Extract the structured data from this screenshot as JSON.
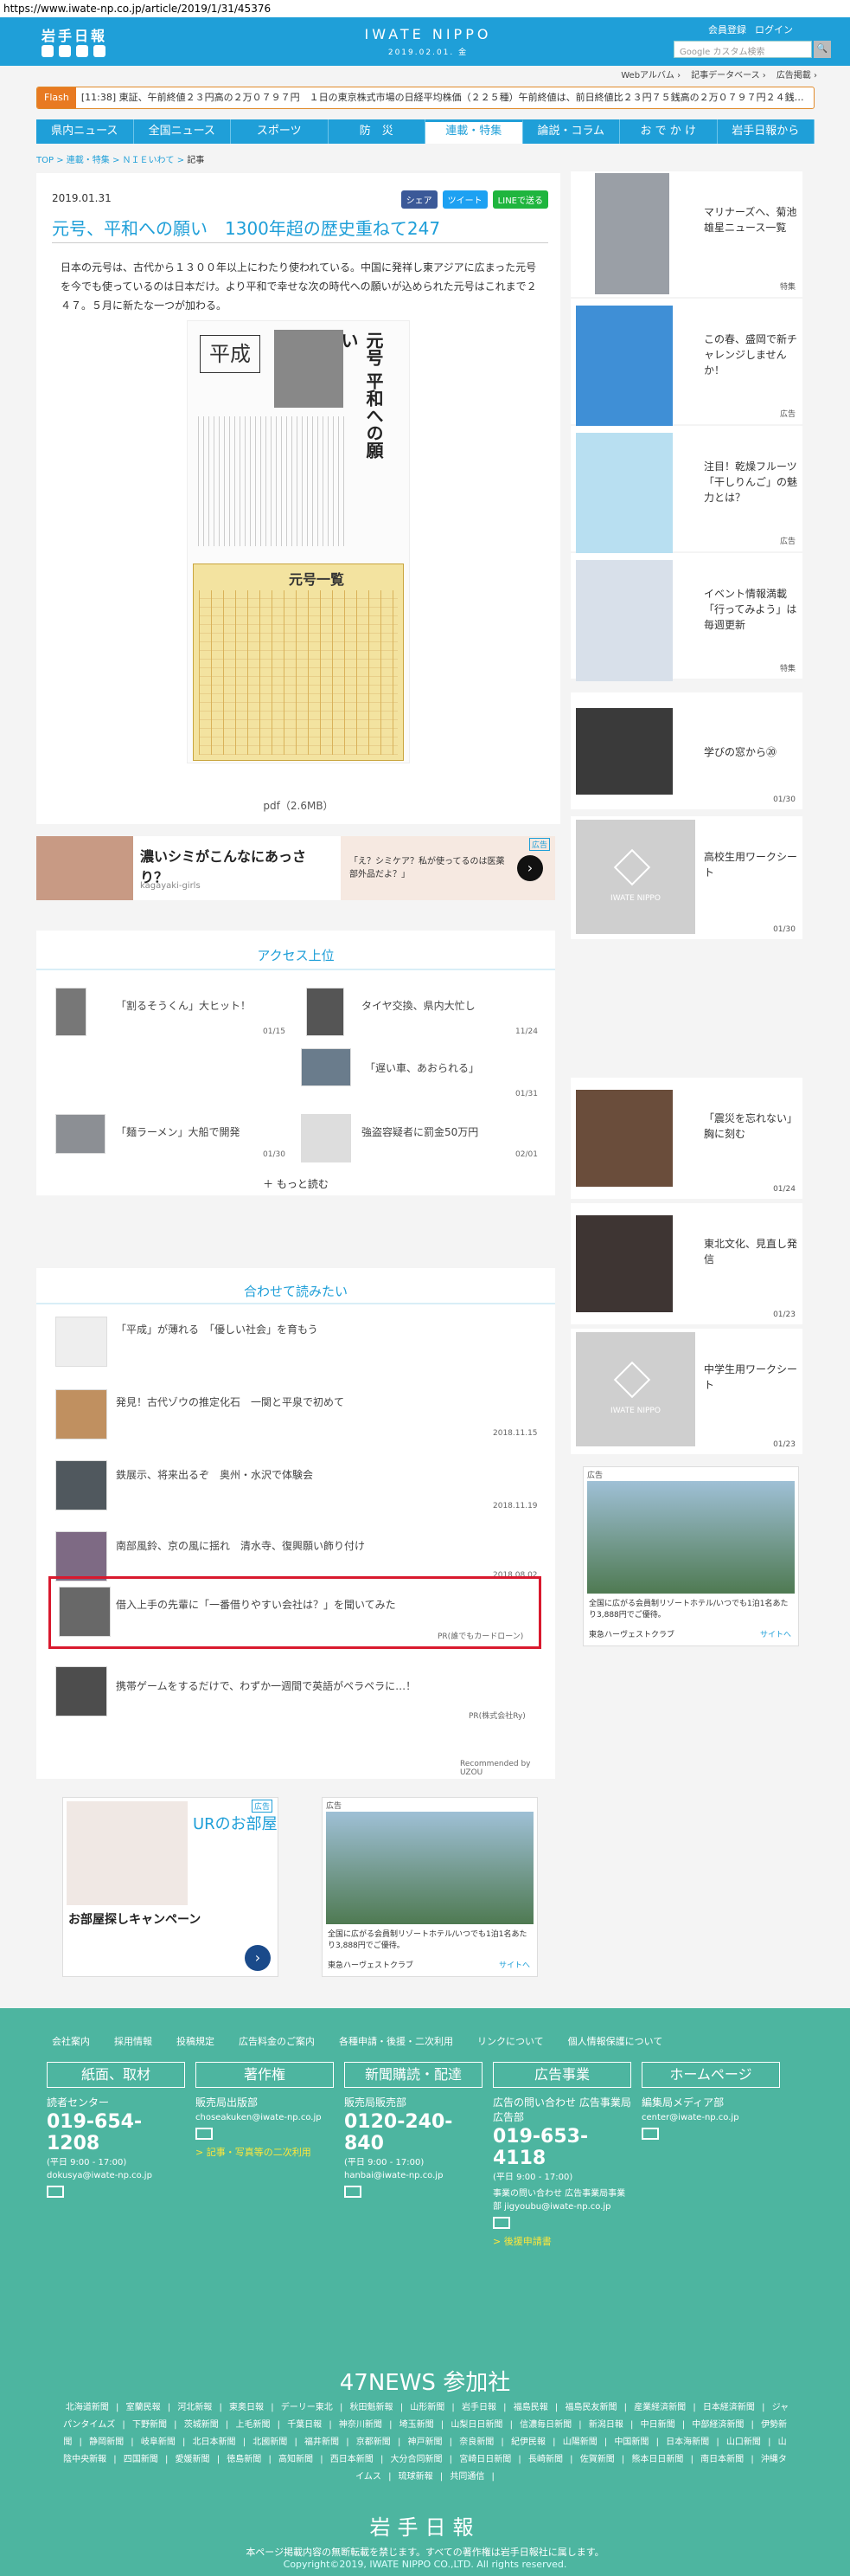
{
  "browser": {
    "url": "https://www.iwate-np.co.jp/article/2019/1/31/45376"
  },
  "header": {
    "logo": "岩手日報",
    "brand": "IWATE NIPPO",
    "date": "2019.02.01. 金",
    "links": [
      "会員登録",
      "ログイン"
    ],
    "search_placeholder": "Google カスタム検索",
    "sub_links": [
      "Webアルバム ›",
      "記事データベース ›",
      "広告掲載 ›"
    ]
  },
  "flash": {
    "label": "Flash",
    "time": "[11:38]",
    "text": "東証、午前終値２３円高の２万０７９７円　１日の東京株式市場の日経平均株価（２２５種）午前終値は、前日終値比２３円７５銭高の２万０７９７円２４銭…"
  },
  "nav": [
    "県内ニュース",
    "全国ニュース",
    "スポーツ",
    "防　災",
    "連載・特集",
    "論説・コラム",
    "お で か け",
    "岩手日報から"
  ],
  "breadcrumb": [
    "TOP",
    "連載・特集",
    "ＮＩＥいわて",
    "記事"
  ],
  "article": {
    "date": "2019.01.31",
    "share": [
      "シェア",
      "ツイート",
      "LINEで送る"
    ],
    "title": "元号、平和への願い　1300年超の歴史重ねて247",
    "body": "日本の元号は、古代から１３００年以上にわたり使われている。中国に発祥し東アジアに広まった元号を今でも使っているのは日本だけ。より平和で幸せな次の時代への願いが込められた元号はこれまで２４７。５月に新たな一つが加わる。",
    "scan_heading": "元号 平和への願い",
    "scan_sign": "平成",
    "scan_table_title": "元号一覧",
    "pdf": "pdf（2.6MB）"
  },
  "ad_banner": {
    "title": "濃いシミがこんなにあっさり？",
    "source": "kagayaki-girls",
    "copy": "「え？シミケア？私が使ってるのは医薬部外品だよ？」",
    "badge": "広告"
  },
  "access": {
    "heading": "アクセス上位",
    "items": [
      {
        "title": "「割るそうくん」大ヒット！",
        "date": "01/15"
      },
      {
        "title": "タイヤ交換、県内大忙し",
        "date": "11/24"
      },
      {
        "title": "「遅い車、あおられる」",
        "date": "01/31"
      },
      {
        "title": "「麺ラーメン」大船で開発",
        "date": "01/30"
      },
      {
        "title": "強盗容疑者に罰金50万円",
        "date": "02/01"
      }
    ],
    "more": "もっと読む"
  },
  "related": {
    "heading": "合わせて読みたい",
    "items": [
      {
        "title": "「平成」が薄れる　「優しい社会」を育もう",
        "date": ""
      },
      {
        "title": "発見！古代ゾウの推定化石　一関と平泉で初めて",
        "date": "2018.11.15"
      },
      {
        "title": "鉄展示、将来出るぞ　奥州・水沢で体験会",
        "date": "2018.11.19"
      },
      {
        "title": "南部風鈴、京の風に揺れ　清水寺、復興願い飾り付け",
        "date": "2018.08.02"
      },
      {
        "title": "借入上手の先輩に「一番借りやすい会社は？」を聞いてみた",
        "date": "PR(誰でもカードローン)"
      },
      {
        "title": "携帯ゲームをするだけで、わずか一週間で英語がペラペラに…！",
        "date": "PR(株式会社Ry)"
      }
    ],
    "recommend": "Recommended by UZOU"
  },
  "sidebar": [
    {
      "title": "マリナーズへ、菊池雄星ニュース一覧",
      "tag": "特集"
    },
    {
      "title": "この春、盛岡で新チャレンジしませんか！",
      "tag": "広告"
    },
    {
      "title": "注目！乾燥フルーツ「干しりんご」の魅力とは？",
      "tag": "広告"
    },
    {
      "title": "イベント情報満載「行ってみよう」は毎週更新",
      "tag": "特集"
    },
    {
      "title": "学びの窓から⑳",
      "tag": "01/30"
    },
    {
      "title": "高校生用ワークシート",
      "tag": "01/30"
    },
    {
      "title": "「震災を忘れない」胸に刻む",
      "tag": "01/24"
    },
    {
      "title": "東北文化、見直し発信",
      "tag": "01/23"
    },
    {
      "title": "中学生用ワークシート",
      "tag": "01/23"
    }
  ],
  "placeholder_logo": "IWATE NIPPO",
  "resort_ad": {
    "badge": "広告",
    "text": "全国に広がる会員制リゾートホテル/いつでも1泊1名あたり3,888円でご優待。",
    "brand": "東急ハーヴェストクラブ",
    "site": "サイトへ"
  },
  "ur_ad": {
    "badge": "広告",
    "title": "お部屋探しキャンペーン",
    "logo": "URのお部屋"
  },
  "footer": {
    "links": [
      "会社案内",
      "採用情報",
      "投稿規定",
      "広告料金のご案内",
      "各種申請・後援・二次利用",
      "リンクについて",
      "個人情報保護について"
    ],
    "cols": [
      {
        "box": "紙面、取材",
        "l1": "読者センター",
        "tel": "019-654-1208",
        "l2": "(平日 9:00 - 17:00)",
        "mail": "dokusya@iwate-np.co.jp"
      },
      {
        "box": "著作権",
        "l1": "販売局出版部",
        "tel": "",
        "l2": "",
        "mail": "choseakuken@iwate-np.co.jp",
        "extra": "> 記事・写真等の二次利用"
      },
      {
        "box": "新聞購読・配達",
        "l1": "販売局販売部",
        "tel": "0120-240-840",
        "l2": "(平日 9:00 - 17:00)",
        "mail": "hanbai@iwate-np.co.jp"
      },
      {
        "box": "広告事業",
        "l1": "広告の問い合わせ 広告事業局広告部",
        "tel": "019-653-4118",
        "l2": "(平日 9:00 - 17:00)",
        "mail": "事業の問い合わせ 広告事業局事業部 jigyoubu@iwate-np.co.jp",
        "extra": "> 後援申請書"
      },
      {
        "box": "ホームページ",
        "l1": "編集局メディア部",
        "tel": "",
        "l2": "",
        "mail": "center@iwate-np.co.jp"
      }
    ],
    "news47": "47NEWS 参加社",
    "papers": [
      "北海道新聞",
      "室蘭民報",
      "河北新報",
      "東奥日報",
      "デーリー東北",
      "秋田魁新報",
      "山形新聞",
      "岩手日報",
      "福島民報",
      "福島民友新聞",
      "産業経済新聞",
      "日本経済新聞",
      "ジャパンタイムズ",
      "下野新聞",
      "茨城新聞",
      "上毛新聞",
      "千葉日報",
      "神奈川新聞",
      "埼玉新聞",
      "山梨日日新聞",
      "信濃毎日新聞",
      "新潟日報",
      "中日新聞",
      "中部経済新聞",
      "伊勢新聞",
      "静岡新聞",
      "岐阜新聞",
      "北日本新聞",
      "北國新聞",
      "福井新聞",
      "京都新聞",
      "神戸新聞",
      "奈良新聞",
      "紀伊民報",
      "山陽新聞",
      "中国新聞",
      "日本海新聞",
      "山口新聞",
      "山陰中央新報",
      "四国新聞",
      "愛媛新聞",
      "徳島新聞",
      "高知新聞",
      "西日本新聞",
      "大分合同新聞",
      "宮崎日日新聞",
      "長崎新聞",
      "佐賀新聞",
      "熊本日日新聞",
      "南日本新聞",
      "沖縄タイムス",
      "琉球新報",
      "共同通信"
    ],
    "logo": "岩手日報",
    "copy1": "本ページ掲載内容の無断転載を禁じます。すべての著作権は岩手日報社に属します。",
    "copy2": "Copyright©2019, IWATE NIPPO CO.,LTD. All rights reserved."
  }
}
